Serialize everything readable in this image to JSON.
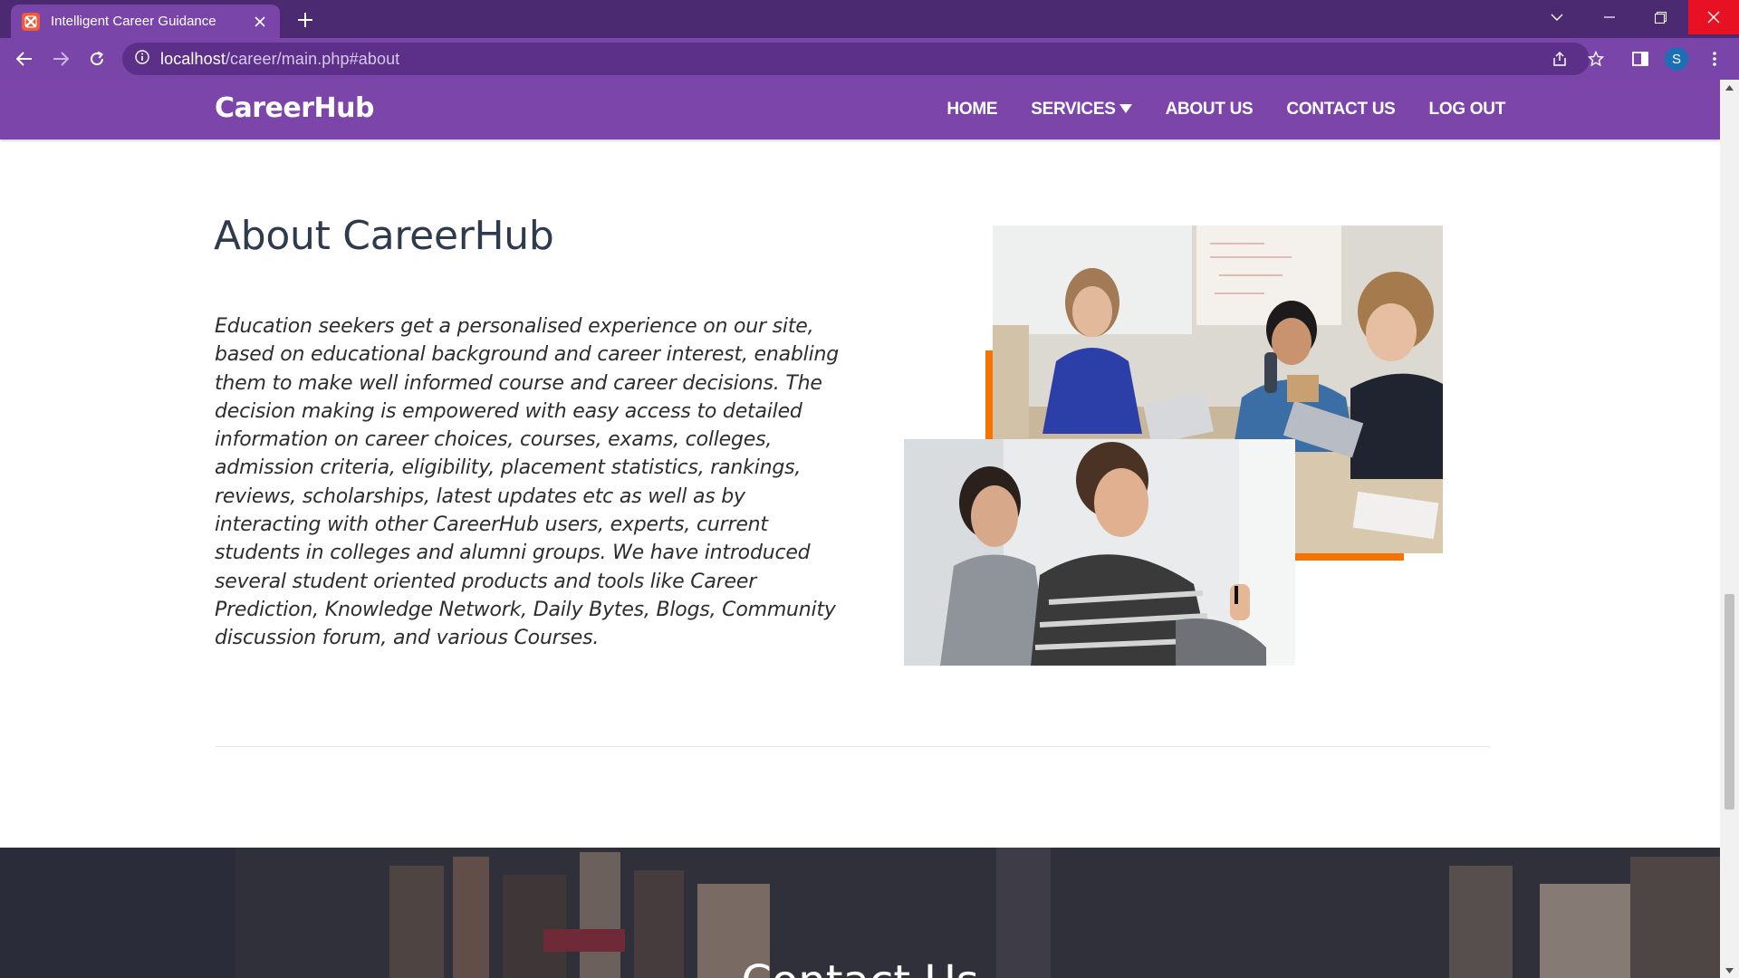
{
  "browser": {
    "tab_title": "Intelligent Career Guidance",
    "url_host": "localhost",
    "url_path": "/career/main.php#about",
    "profile_initial": "S"
  },
  "nav": {
    "brand": "CareerHub",
    "links": [
      "HOME",
      "SERVICES",
      "ABOUT US",
      "CONTACT US",
      "LOG OUT"
    ]
  },
  "about": {
    "title": "About CareerHub",
    "body": "Education seekers get a personalised experience on our site, based on educational background and career interest, enabling them to make well informed course and career decisions. The decision making is empowered with easy access to detailed information on career choices, courses, exams, colleges, admission criteria, eligibility, placement statistics, rankings, reviews, scholarships, latest updates etc as well as by interacting with other CareerHub users, experts, current students in colleges and alumni groups. We have introduced several student oriented products and tools like Career Prediction, Knowledge Network, Daily Bytes, Blogs, Community discussion forum, and various Courses."
  },
  "contact": {
    "title": "Contact Us"
  },
  "colors": {
    "chrome_dark": "#4b2a72",
    "chrome": "#7a45a8",
    "nav_bg": "#7b45a9",
    "accent": "#f57300",
    "heading": "#2f3b4c"
  }
}
